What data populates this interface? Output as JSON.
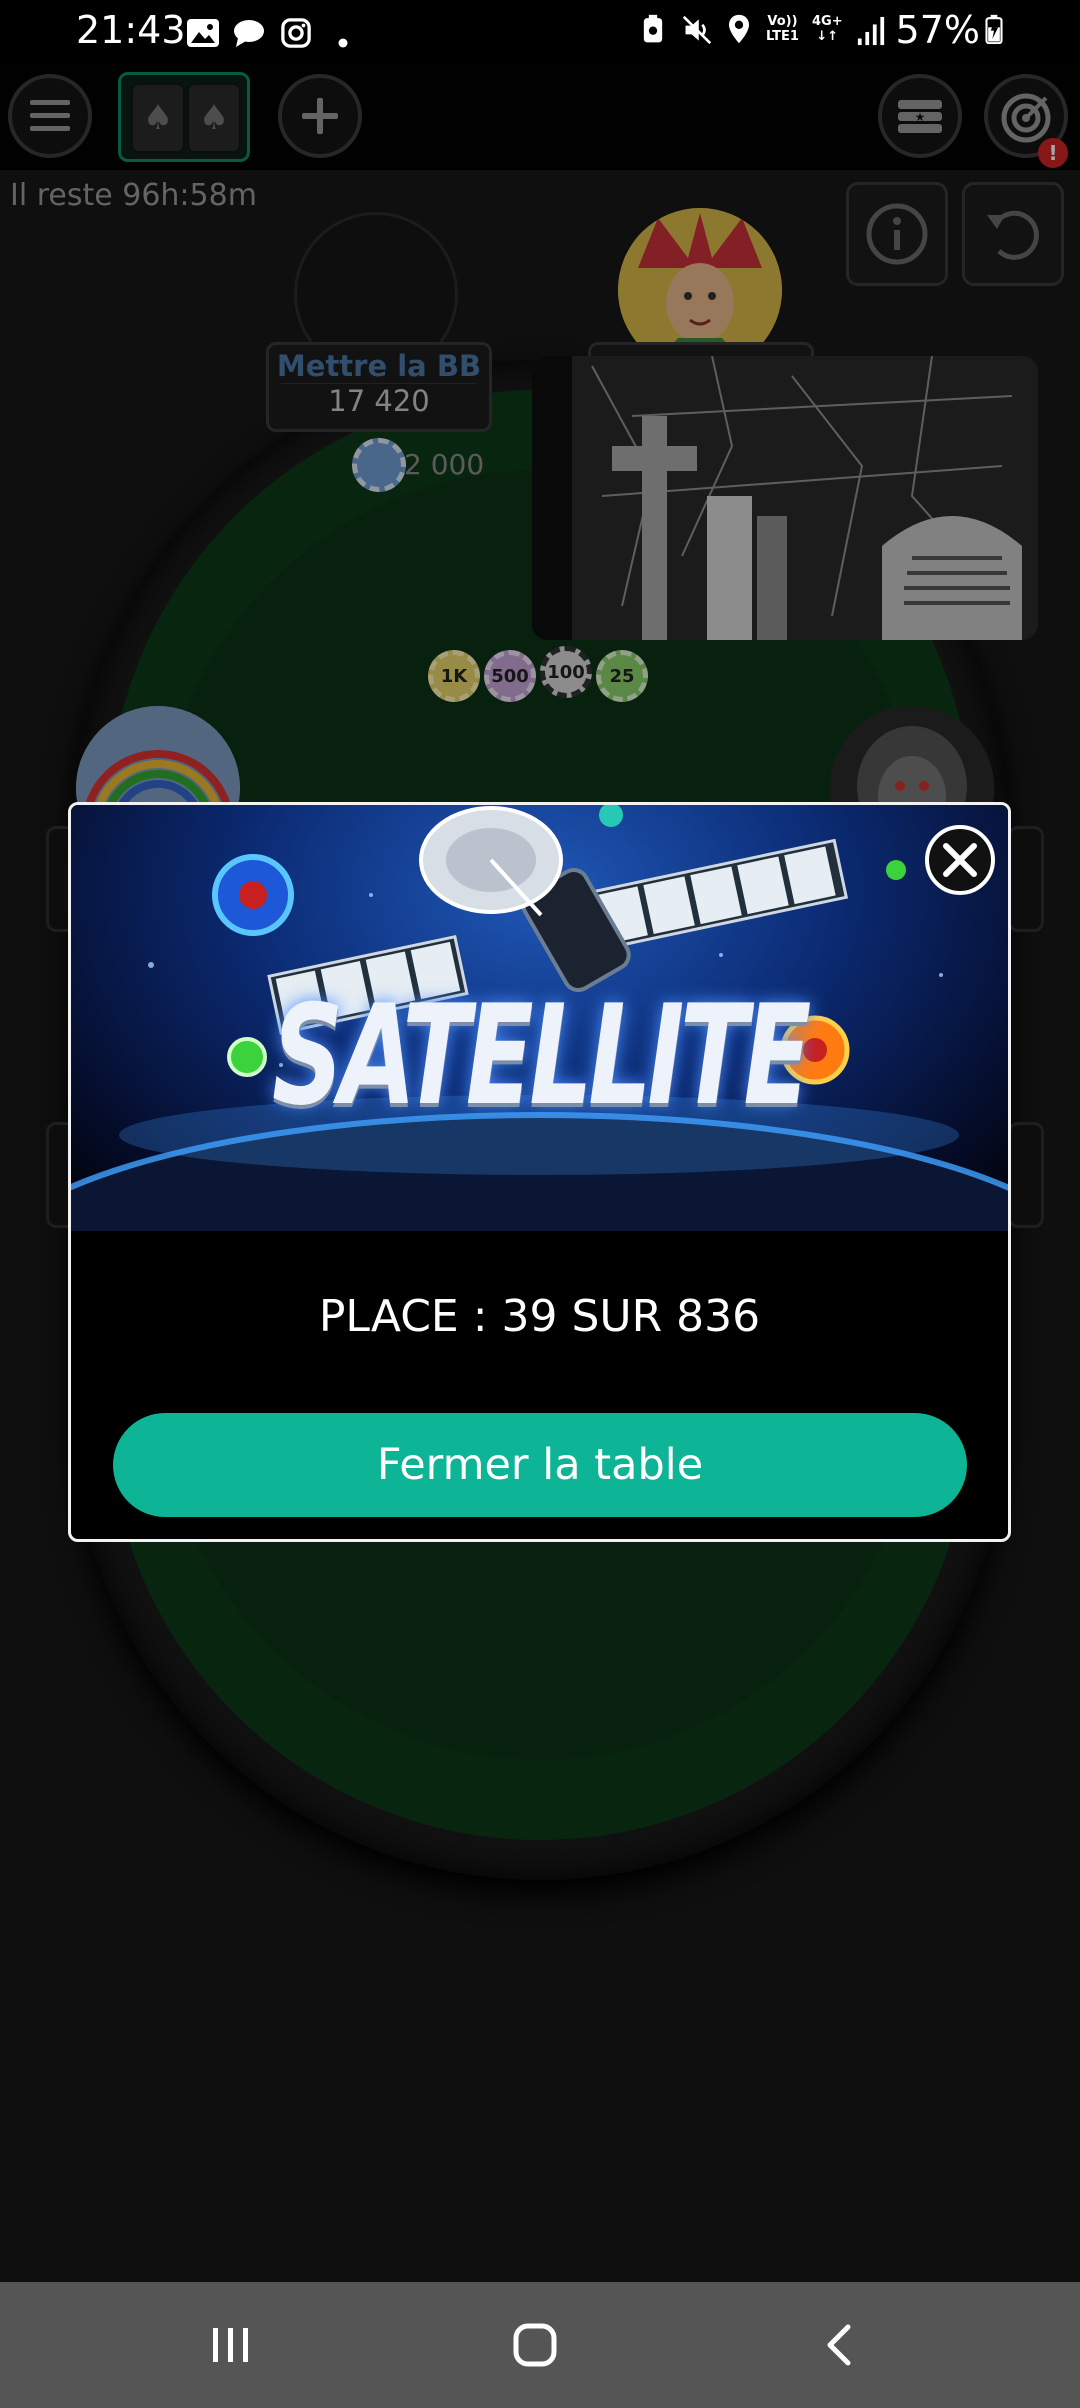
{
  "status_bar": {
    "time": "21:43",
    "network_top": "Vo))",
    "network_bottom": "LTE1",
    "data_type": "4G+",
    "battery": "57%"
  },
  "toolbar": {
    "menu_icon": "hamburger-icon",
    "add_icon": "plus-icon",
    "cashier_icon": "chip-stack-icon",
    "missions_icon": "target-icon",
    "missions_badge": "!"
  },
  "table": {
    "timer": "Il reste 96h:58m",
    "seat_action": "Mettre la  BB",
    "seat_stack": "17 420",
    "bet_amount": "2 000",
    "pot_chips": [
      "1K",
      "500",
      "100",
      "25"
    ]
  },
  "modal": {
    "banner_title": "SATELLITE",
    "place_text": "PLACE : 39 SUR 836",
    "close_button_label": "Fermer la table"
  },
  "colors": {
    "accent": "#0db596",
    "felt": "#0d3a1a",
    "background": "#171717"
  }
}
